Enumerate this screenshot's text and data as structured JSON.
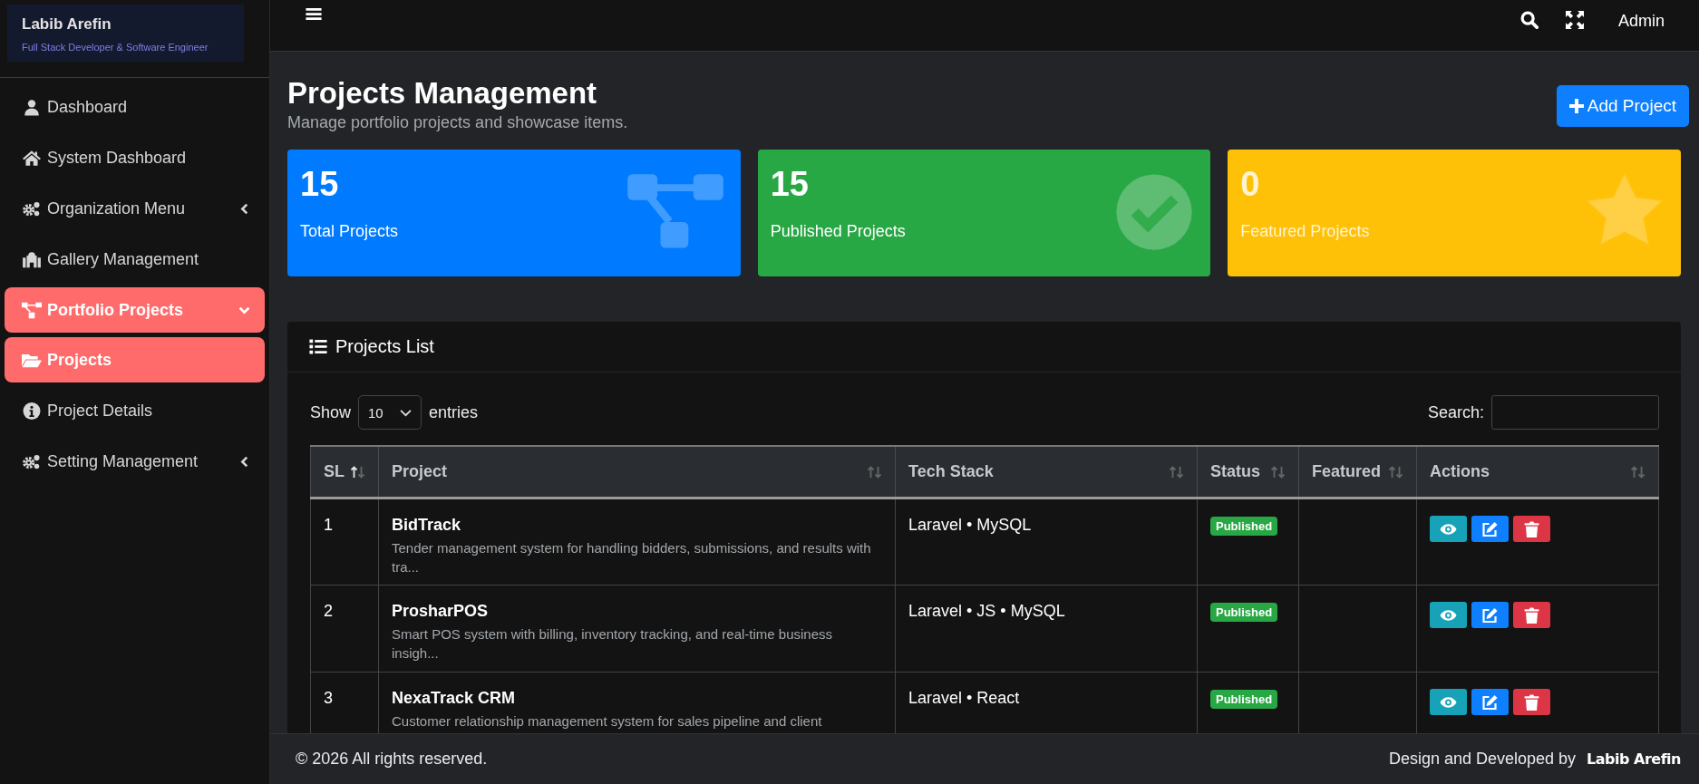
{
  "sidebar": {
    "brand": {
      "name": "Labib Arefin",
      "tagline": "Full Stack Developer & Software Engineer"
    },
    "items": [
      {
        "label": "Dashboard",
        "selected": false
      },
      {
        "label": "System Dashboard",
        "selected": false
      },
      {
        "label": "Organization Menu",
        "selected": false,
        "expanded": false
      },
      {
        "label": "Gallery Management",
        "selected": false
      },
      {
        "label": "Portfolio Projects",
        "selected": true,
        "expanded": true
      },
      {
        "label": "Projects",
        "selected": true
      },
      {
        "label": "Project Details",
        "selected": false
      },
      {
        "label": "Setting Management",
        "selected": false,
        "expanded": false
      }
    ]
  },
  "header": {
    "user": "Admin"
  },
  "page": {
    "title": "Projects Management",
    "subtitle": "Manage portfolio projects and showcase items.",
    "add_button": "Add Project"
  },
  "stats": [
    {
      "value": "15",
      "label": "Total Projects",
      "color": "#007bff"
    },
    {
      "value": "15",
      "label": "Published Projects",
      "color": "#28a745"
    },
    {
      "value": "0",
      "label": "Featured Projects",
      "color": "#ffc107"
    }
  ],
  "projects_list": {
    "title": "Projects List",
    "show_label": "Show",
    "entries_value": "10",
    "entries_label": "entries",
    "search_label": "Search:",
    "columns": [
      {
        "label": "SL",
        "sorted": true
      },
      {
        "label": "Project",
        "sorted": false
      },
      {
        "label": "Tech Stack",
        "sorted": false
      },
      {
        "label": "Status",
        "sorted": false
      },
      {
        "label": "Featured",
        "sorted": false
      },
      {
        "label": "Actions",
        "sorted": false
      }
    ],
    "rows": [
      {
        "sl": "1",
        "name": "BidTrack",
        "description": "Tender management system for handling bidders, submissions, and results with tra...",
        "tech": "Laravel • MySQL",
        "status": "Published"
      },
      {
        "sl": "2",
        "name": "ProsharPOS",
        "description": "Smart POS system with billing, inventory tracking, and real-time business insigh...",
        "tech": "Laravel • JS • MySQL",
        "status": "Published"
      },
      {
        "sl": "3",
        "name": "NexaTrack CRM",
        "description": "Customer relationship management system for sales pipeline and client",
        "tech": "Laravel • React",
        "status": "Published"
      }
    ]
  },
  "footer": {
    "copyright": "© 2026  All rights reserved.",
    "credit": "Design and Developed by",
    "credit_name": "Labib Arefin"
  }
}
